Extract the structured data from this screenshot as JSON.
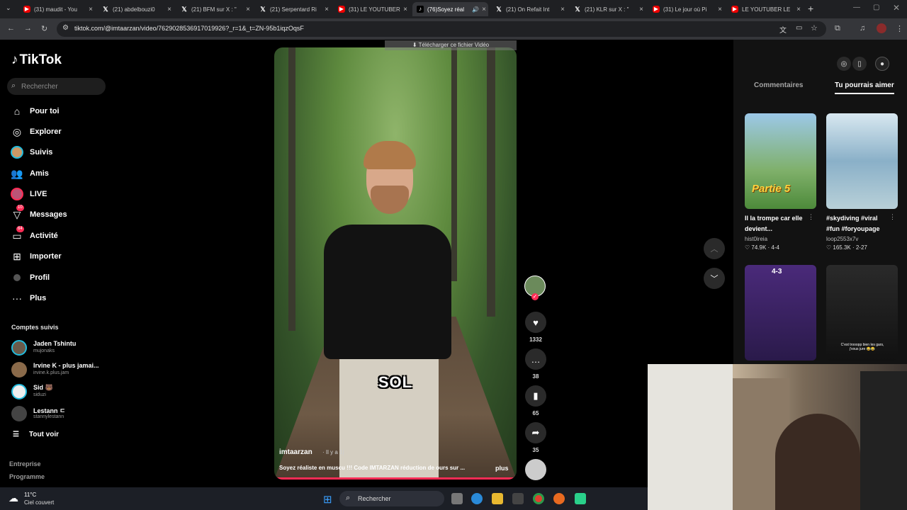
{
  "browser": {
    "tabs": [
      {
        "title": "(31) maudit - You",
        "icon": "youtube-icon"
      },
      {
        "title": "(21) abdelbouzi0",
        "icon": "x-icon"
      },
      {
        "title": "(21) BFM sur X : \"",
        "icon": "x-icon"
      },
      {
        "title": "(21) Serpentard Ri",
        "icon": "x-icon"
      },
      {
        "title": "(31) LE YOUTUBER",
        "icon": "youtube-icon"
      },
      {
        "title": "(76)Soyez réal",
        "icon": "tiktok-icon",
        "active": true
      },
      {
        "title": "(21) On Refait Int",
        "icon": "x-icon"
      },
      {
        "title": "(21) KLR sur X : \"",
        "icon": "x-icon"
      },
      {
        "title": "(31) Le jour où Pi",
        "icon": "youtube-icon"
      },
      {
        "title": "LE YOUTUBER LE",
        "icon": "youtube-icon"
      }
    ],
    "url": "tiktok.com/@imtaarzan/video/7629028536917019926?_r=1&_t=ZN-95b1iqzOqsF"
  },
  "tiktok": {
    "logo": "TikTok",
    "search_placeholder": "Rechercher",
    "nav": [
      {
        "label": "Pour toi",
        "icon": "home-icon"
      },
      {
        "label": "Explorer",
        "icon": "compass-icon"
      },
      {
        "label": "Suivis",
        "icon": "following-avatar-icon"
      },
      {
        "label": "Amis",
        "icon": "friends-icon"
      },
      {
        "label": "LIVE",
        "icon": "live-icon"
      },
      {
        "label": "Messages",
        "icon": "messages-icon",
        "badge": "10"
      },
      {
        "label": "Activité",
        "icon": "activity-icon",
        "badge": "64"
      },
      {
        "label": "Importer",
        "icon": "upload-icon"
      },
      {
        "label": "Profil",
        "icon": "profile-icon"
      },
      {
        "label": "Plus",
        "icon": "more-icon"
      }
    ],
    "following_header": "Comptes suivis",
    "following": [
      {
        "name": "Jaden Tshintu",
        "handle": "mujonaks"
      },
      {
        "name": "Irvine K - plus jamai...",
        "handle": "irvine.k.plus.jam"
      },
      {
        "name": "Sid 🐻",
        "handle": "siduzi"
      },
      {
        "name": "Lestann ㄷ",
        "handle": "stannylestann"
      }
    ],
    "see_all": "Tout voir",
    "footer": [
      "Entreprise",
      "Programme"
    ],
    "download_banner": "⬇ Télécharger ce fichier Vidéo",
    "video": {
      "caption_word": "SOL",
      "author": "imtaarzan",
      "time": "· Il y a 1j",
      "description": "Soyez réaliste en muscu !!! Code IMTARZAN réduction de ours sur ...",
      "more": "plus",
      "progress": 0.99
    },
    "actions": {
      "likes": "1332",
      "comments": "38",
      "saves": "65",
      "shares": "35"
    },
    "panel": {
      "tab_comments": "Commentaires",
      "tab_suggest": "Tu pourrais aimer",
      "cards": [
        {
          "title": "Il la trompe car elle devient...",
          "author": "hist0ireia",
          "stats": "♡ 74.9K · 4-4",
          "overlay": "Partie 5"
        },
        {
          "title": "#skydiving #viral #fun #foryoupage",
          "author": "loop2553x7v",
          "stats": "♡ 165.3K · 2-27",
          "overlay": ""
        },
        {
          "title": "",
          "author": "",
          "stats": "",
          "overlay": "4-3"
        },
        {
          "title": "",
          "author": "",
          "stats": "",
          "overlay": "C'est trooopp bien les gars, j'vous jure 😂😂"
        }
      ]
    }
  },
  "taskbar": {
    "temp": "11°C",
    "weather": "Ciel couvert",
    "search_placeholder": "Rechercher"
  }
}
